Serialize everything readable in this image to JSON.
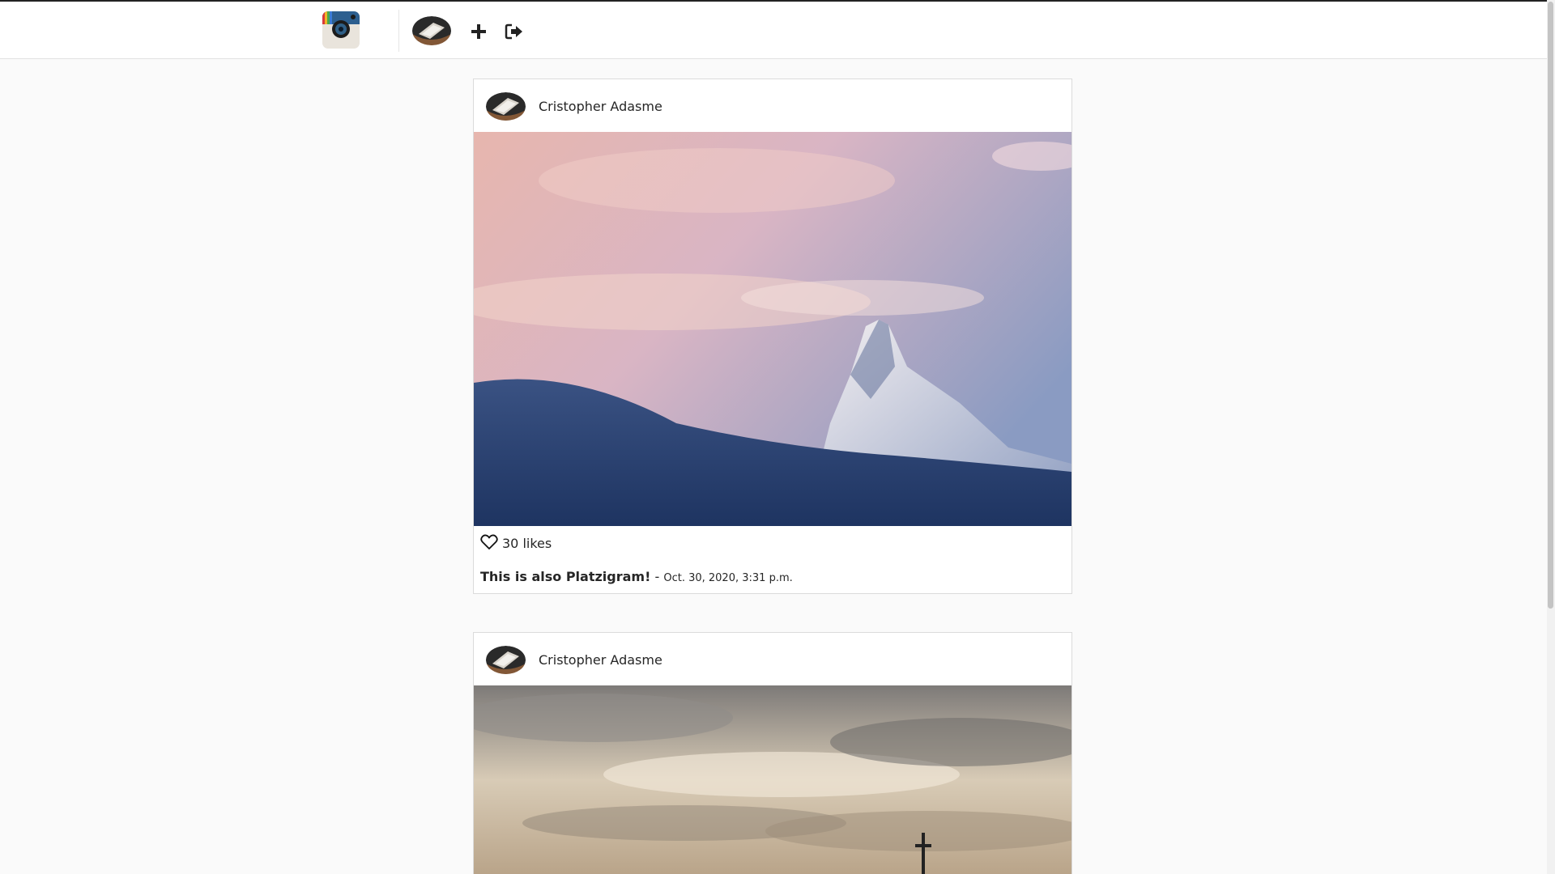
{
  "nav": {
    "logo_icon": "camera-app-logo",
    "avatar_icon": "user-avatar",
    "add_icon": "plus-icon",
    "logout_icon": "logout-icon"
  },
  "posts": [
    {
      "author": "Cristopher Adasme",
      "image": "snowy mountain peak at sunset",
      "likes": "30 likes",
      "caption_title": "This is also Platzigram!",
      "caption_separator": " - ",
      "date": "Oct. 30, 2020, 3:31 p.m."
    },
    {
      "author": "Cristopher Adasme",
      "image": "cloudy sky with summit cross"
    }
  ],
  "colors": {
    "background": "#fafafa",
    "card": "#ffffff",
    "border": "#dbdbdb",
    "text": "#262626"
  }
}
